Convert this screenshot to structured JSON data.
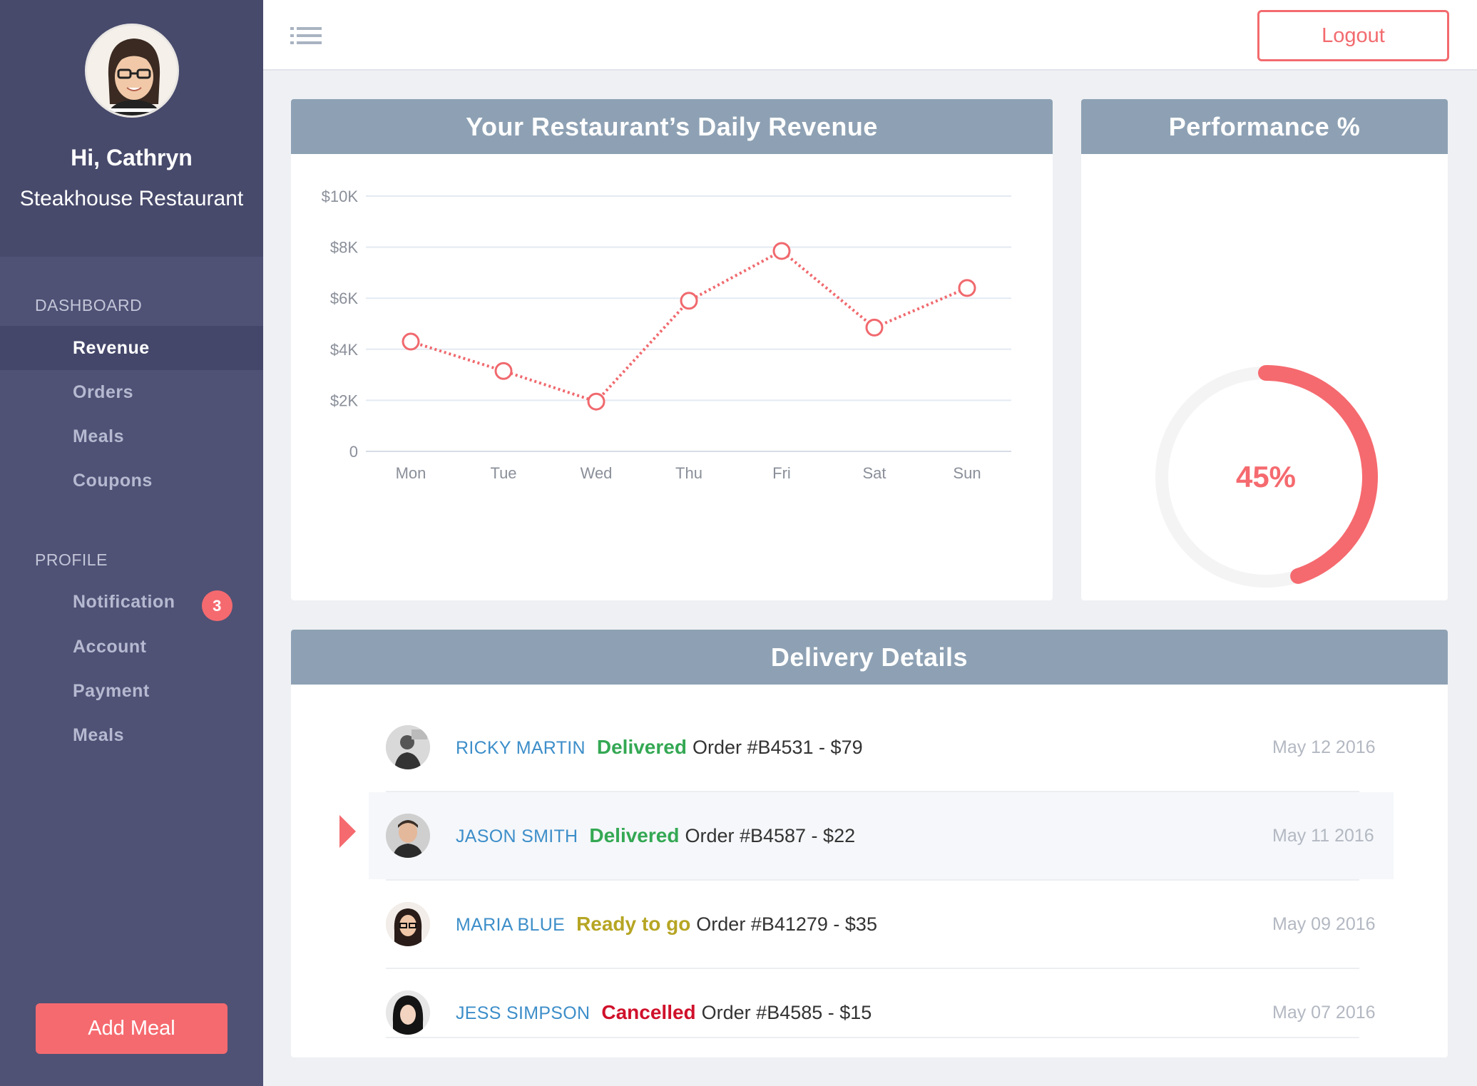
{
  "sidebar": {
    "greeting": "Hi, Cathryn",
    "restaurant": "Steakhouse Restaurant",
    "dashboard_title": "DASHBOARD",
    "dashboard_items": [
      {
        "label": "Revenue",
        "active": true
      },
      {
        "label": "Orders",
        "active": false
      },
      {
        "label": "Meals",
        "active": false
      },
      {
        "label": "Coupons",
        "active": false
      }
    ],
    "profile_title": "PROFILE",
    "profile_items": [
      {
        "label": "Notification",
        "badge": "3"
      },
      {
        "label": "Account"
      },
      {
        "label": "Payment"
      },
      {
        "label": "Meals"
      }
    ],
    "add_meal_label": "Add Meal"
  },
  "topbar": {
    "menu_icon": "hamburger-list-icon",
    "logout_label": "Logout"
  },
  "revenue": {
    "title": "Your Restaurant’s Daily Revenue"
  },
  "chart_data": {
    "type": "line",
    "title": "Your Restaurant’s Daily Revenue",
    "categories": [
      "Mon",
      "Tue",
      "Wed",
      "Thu",
      "Fri",
      "Sat",
      "Sun"
    ],
    "values": [
      4300,
      3150,
      1950,
      5900,
      7850,
      4850,
      6400
    ],
    "ylim": [
      0,
      10000
    ],
    "yticks": [
      0,
      2000,
      4000,
      6000,
      8000,
      10000
    ],
    "ytick_labels": [
      "0",
      "$2K",
      "$4K",
      "$6K",
      "$8K",
      "$10K"
    ],
    "line_style": "dotted",
    "color": "#f0696e",
    "grid": true
  },
  "performance": {
    "title": "Performance %",
    "value": 45,
    "label": "45%",
    "color": "#f56a6f",
    "track_color": "#f4f4f4"
  },
  "delivery": {
    "title": "Delivery Details",
    "rows": [
      {
        "customer": "RICKY MARTIN",
        "status": "Delivered",
        "status_color": "#34a853",
        "order": "Order #B4531 - $79",
        "date": "May 12 2016",
        "selected": false
      },
      {
        "customer": "JASON SMITH",
        "status": "Delivered",
        "status_color": "#34a853",
        "order": "Order #B4587 - $22",
        "date": "May 11 2016",
        "selected": true
      },
      {
        "customer": "MARIA BLUE",
        "status": "Ready to go",
        "status_color": "#b6a523",
        "order": "Order #B41279 - $35",
        "date": "May 09 2016",
        "selected": false
      },
      {
        "customer": "JESS SIMPSON",
        "status": "Cancelled",
        "status_color": "#d0112b",
        "order": "Order #B4585 - $15",
        "date": "May 07 2016",
        "selected": false
      }
    ]
  }
}
